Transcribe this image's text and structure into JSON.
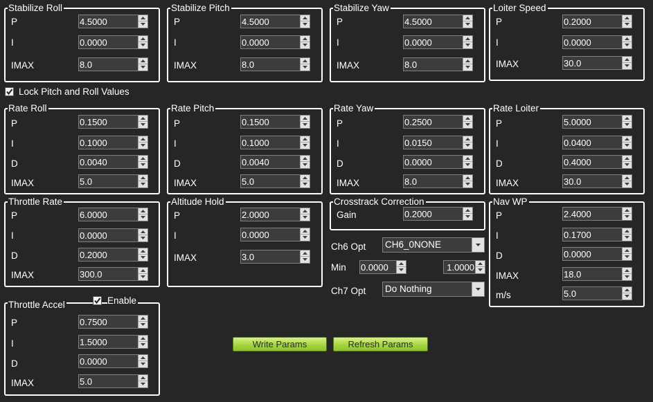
{
  "groups": {
    "stab_roll": {
      "title": "Stabilize Roll",
      "p_label": "P",
      "p": "4.5000",
      "i_label": "I",
      "i": "0.0000",
      "imax_label": "IMAX",
      "imax": "8.0"
    },
    "stab_pitch": {
      "title": "Stabilize Pitch",
      "p_label": "P",
      "p": "4.5000",
      "i_label": "I",
      "i": "0.0000",
      "imax_label": "IMAX",
      "imax": "8.0"
    },
    "stab_yaw": {
      "title": "Stabilize Yaw",
      "p_label": "P",
      "p": "4.5000",
      "i_label": "I",
      "i": "0.0000",
      "imax_label": "IMAX",
      "imax": "8.0"
    },
    "loiter_speed": {
      "title": "Loiter Speed",
      "p_label": "P",
      "p": "0.2000",
      "i_label": "I",
      "i": "0.0000",
      "imax_label": "IMAX",
      "imax": "30.0"
    },
    "rate_roll": {
      "title": "Rate Roll",
      "p_label": "P",
      "p": "0.1500",
      "i_label": "I",
      "i": "0.1000",
      "d_label": "D",
      "d": "0.0040",
      "imax_label": "IMAX",
      "imax": "5.0"
    },
    "rate_pitch": {
      "title": "Rate Pitch",
      "p_label": "P",
      "p": "0.1500",
      "i_label": "I",
      "i": "0.1000",
      "d_label": "D",
      "d": "0.0040",
      "imax_label": "IMAX",
      "imax": "5.0"
    },
    "rate_yaw": {
      "title": "Rate Yaw",
      "p_label": "P",
      "p": "0.2500",
      "i_label": "I",
      "i": "0.0150",
      "d_label": "D",
      "d": "0.0000",
      "imax_label": "IMAX",
      "imax": "8.0"
    },
    "rate_loiter": {
      "title": "Rate Loiter",
      "p_label": "P",
      "p": "5.0000",
      "i_label": "I",
      "i": "0.0400",
      "d_label": "D",
      "d": "0.4000",
      "imax_label": "IMAX",
      "imax": "30.0"
    },
    "throttle_rate": {
      "title": "Throttle Rate",
      "p_label": "P",
      "p": "6.0000",
      "i_label": "I",
      "i": "0.0000",
      "d_label": "D",
      "d": "0.2000",
      "imax_label": "IMAX",
      "imax": "300.0"
    },
    "altitude_hold": {
      "title": "Altitude Hold",
      "p_label": "P",
      "p": "2.0000",
      "i_label": "I",
      "i": "0.0000",
      "imax_label": "IMAX",
      "imax": "3.0"
    },
    "crosstrack": {
      "title": "Crosstrack Correction",
      "gain_label": "Gain",
      "gain": "0.2000"
    },
    "nav_wp": {
      "title": "Nav WP",
      "p_label": "P",
      "p": "2.4000",
      "i_label": "I",
      "i": "0.1700",
      "d_label": "D",
      "d": "0.0000",
      "imax_label": "IMAX",
      "imax": "18.0",
      "ms_label": "m/s",
      "ms": "5.0"
    },
    "throttle_accel": {
      "title": "Throttle Accel",
      "enable_label": "Enable",
      "enable_checked": true,
      "p_label": "P",
      "p": "0.7500",
      "i_label": "I",
      "i": "1.5000",
      "d_label": "D",
      "d": "0.0000",
      "imax_label": "IMAX",
      "imax": "5.0"
    }
  },
  "lock": {
    "label": "Lock Pitch and Roll Values",
    "checked": true
  },
  "ch6": {
    "label": "Ch6 Opt",
    "value": "CH6_0NONE"
  },
  "minmax": {
    "min_label": "Min",
    "min": "0.0000",
    "max": "1.0000"
  },
  "ch7": {
    "label": "Ch7 Opt",
    "value": "Do Nothing"
  },
  "buttons": {
    "write": "Write Params",
    "refresh": "Refresh Params"
  },
  "icons": {
    "spin_up": "triangle-up-icon",
    "spin_down": "triangle-down-icon",
    "dropdown": "chevron-down-icon",
    "check": "checkmark-icon"
  },
  "colors": {
    "background": "#262626",
    "field": "#3c3c3c",
    "button_green": "#a6d63e"
  }
}
